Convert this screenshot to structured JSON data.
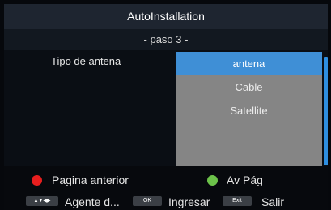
{
  "header": {
    "title": "AutoInstallation",
    "step": "- paso 3 -"
  },
  "field": {
    "label": "Tipo de antena"
  },
  "options": [
    {
      "label": "antena",
      "selected": true
    },
    {
      "label": "Cable",
      "selected": false
    },
    {
      "label": "Satellite",
      "selected": false
    }
  ],
  "footer": {
    "red_label": "Pagina anterior",
    "green_label": "Av Pág",
    "nav_keys": "▲▼◀▶",
    "nav_label": "Agente d...",
    "ok_key": "OK",
    "ok_label": "Ingresar",
    "exit_key": "Exit",
    "exit_label": "Salir"
  },
  "colors": {
    "accent": "#3f8fd6",
    "red": "#e81e1e",
    "green": "#6cc24a"
  }
}
